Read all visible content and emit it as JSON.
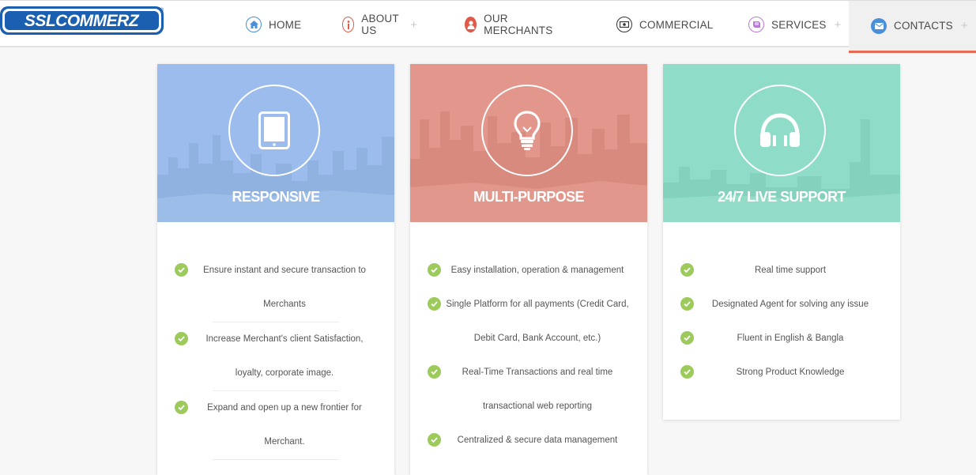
{
  "brand": {
    "logo_text": "SSLCOMMERZ",
    "registered": "®"
  },
  "nav": {
    "items": [
      {
        "label": "HOME",
        "icon": "home-icon",
        "color": "#4a90d9",
        "has_plus": false
      },
      {
        "label": "ABOUT US",
        "icon": "info-icon",
        "color": "#e05a4a",
        "has_plus": true
      },
      {
        "label": "OUR MERCHANTS",
        "icon": "user-icon",
        "color": "#e05a4a",
        "has_plus": false
      },
      {
        "label": "COMMERCIAL",
        "icon": "money-icon",
        "color": "#333333",
        "has_plus": false
      },
      {
        "label": "SERVICES",
        "icon": "book-icon",
        "color": "#b97ad6",
        "has_plus": true
      },
      {
        "label": "CONTACTS",
        "icon": "envelope-icon",
        "color": "#4a90d9",
        "has_plus": true
      }
    ],
    "active": "CONTACTS",
    "plus": "+"
  },
  "cards": [
    {
      "title": "RESPONSIVE",
      "icon": "tablet-icon",
      "color": "#9bbcec",
      "items": [
        "Ensure instant and secure transaction to Merchants",
        "Increase Merchant's client Satisfaction, loyalty, corporate image.",
        "Expand and open up a new frontier for Merchant."
      ]
    },
    {
      "title": "MULTI-PURPOSE",
      "icon": "lightbulb-icon",
      "color": "#e3968b",
      "items": [
        "Easy installation, operation & management",
        "Single Platform for all payments (Credit Card, Debit Card, Bank Account, etc.)",
        "Real-Time Transactions and real time transactional web reporting",
        "Centralized & secure data management"
      ]
    },
    {
      "title": "24/7 LIVE SUPPORT",
      "icon": "headphones-icon",
      "color": "#8fdcc8",
      "items": [
        "Real time support",
        "Designated Agent for solving any issue",
        "Fluent in English & Bangla",
        "Strong Product Knowledge"
      ]
    }
  ],
  "colors": {
    "check": "#9ccb5b",
    "active_underline": "#e76a52"
  }
}
